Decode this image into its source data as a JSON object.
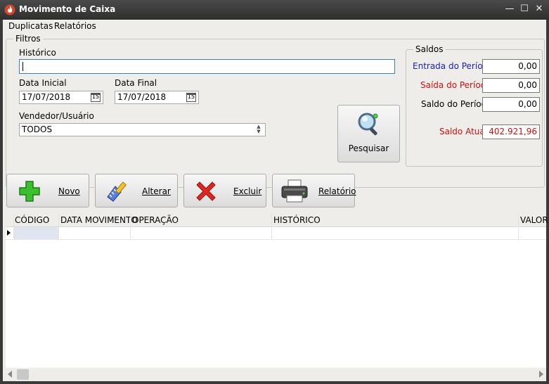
{
  "window": {
    "title": "Movimento de Caixa"
  },
  "menu": {
    "items": [
      "Duplicatas",
      "Relatórios"
    ]
  },
  "filtros": {
    "legend": "Filtros",
    "historico_label": "Histórico",
    "historico_value": "",
    "data_inicial_label": "Data Inicial",
    "data_inicial_value": "17/07/2018",
    "data_final_label": "Data Final",
    "data_final_value": "17/07/2018",
    "calendar_icon_text": "15",
    "vendedor_label": "Vendedor/Usuário",
    "vendedor_value": "TODOS",
    "pesquisar_label": "Pesquisar"
  },
  "saldos": {
    "legend": "Saldos",
    "entrada_label": "Entrada do Período",
    "entrada_value": "0,00",
    "saida_label": "Saída do Período",
    "saida_value": "0,00",
    "saldo_periodo_label": "Saldo do Período",
    "saldo_periodo_value": "0,00",
    "saldo_atual_label": "Saldo Atual:",
    "saldo_atual_value": "402.921,96"
  },
  "toolbar": {
    "novo_label": "Novo",
    "alterar_label": "Alterar",
    "excluir_label": "Excluir",
    "relatorio_label": "Relatório"
  },
  "grid": {
    "columns": [
      "CÓDIGO",
      "DATA MOVIMENTO",
      "OPERAÇÃO",
      "HISTÓRICO",
      "VALOR"
    ]
  },
  "colors": {
    "entrada": "#1c1cc8",
    "saida": "#d01010",
    "saldo_atual": "#d01010",
    "historico_focus_border": "#3c7fb1"
  }
}
